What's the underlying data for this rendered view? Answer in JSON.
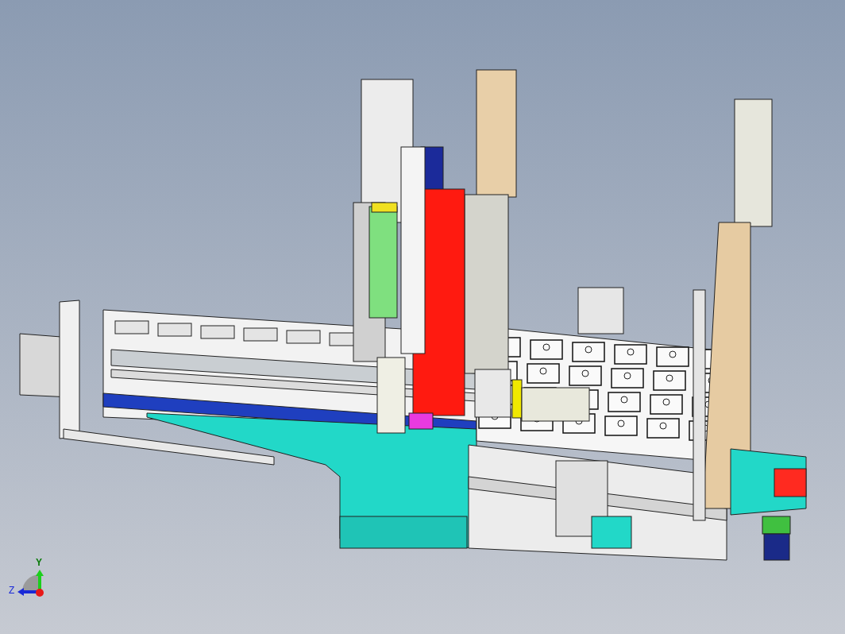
{
  "viewport": {
    "model": {
      "kind": "drawing"
    },
    "triad": {
      "y_label": "Y",
      "z_label": "Z"
    }
  }
}
